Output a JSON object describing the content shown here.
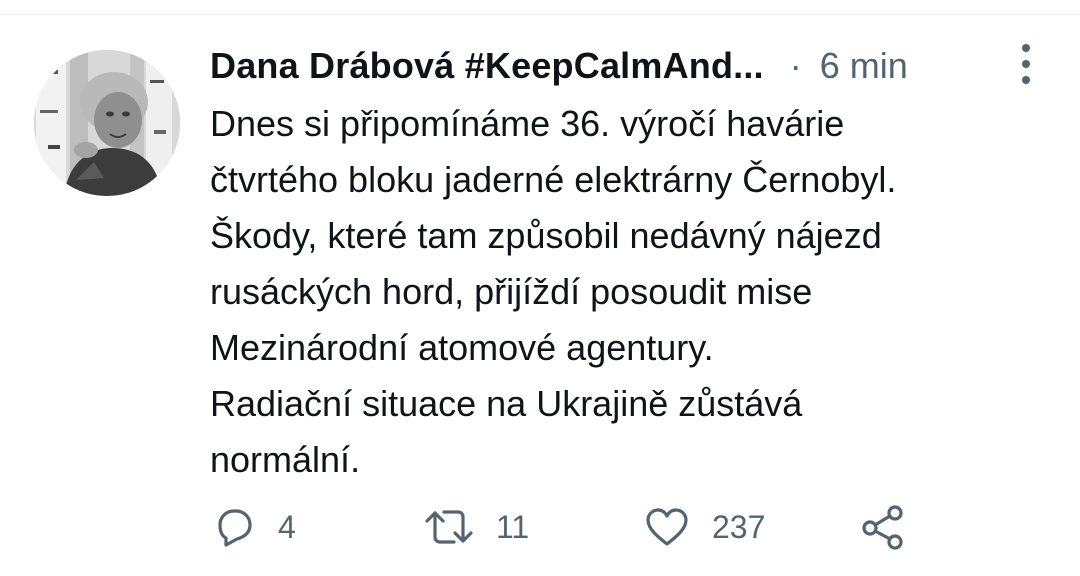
{
  "tweet": {
    "author": {
      "display_name": "Dana Drábová #KeepCalmAnd..."
    },
    "separator": "·",
    "timestamp": "6 min",
    "text_lines": [
      "Dnes si připomínáme 36. výročí havárie",
      "čtvrtého bloku jaderné elektrárny Černobyl.",
      "Škody, které tam způsobil nedávný nájezd",
      "rusáckých hord, přijíždí posoudit mise",
      "Mezinárodní atomové agentury.",
      "Radiační situace na Ukrajině zůstává",
      "normální."
    ],
    "actions": {
      "reply_count": "4",
      "retweet_count": "11",
      "like_count": "237"
    }
  },
  "icons": {
    "more": "more-vertical-icon",
    "reply": "reply-icon",
    "retweet": "retweet-icon",
    "like": "heart-icon",
    "share": "share-icon"
  },
  "colors": {
    "text_primary": "#0f1419",
    "text_secondary": "#536471",
    "divider": "#e6ecf0"
  }
}
